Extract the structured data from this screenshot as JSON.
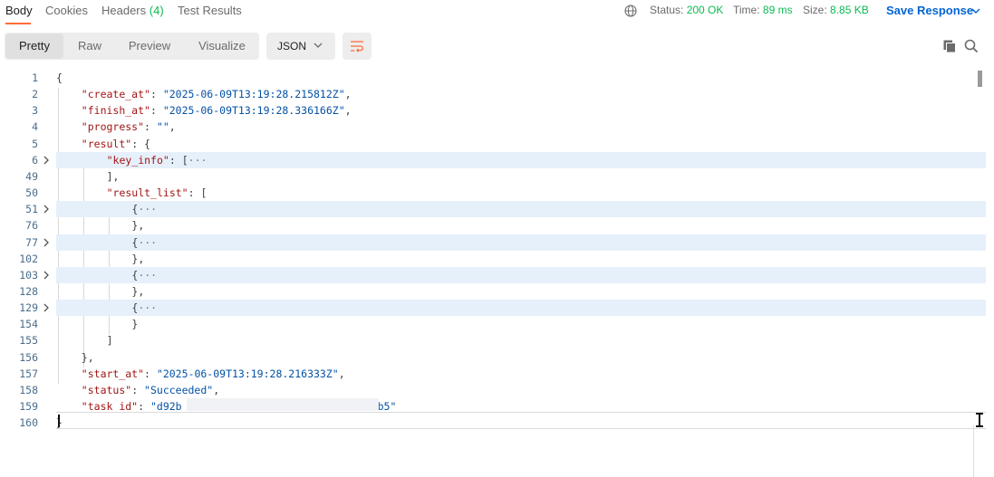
{
  "tabs": [
    {
      "label": "Body"
    },
    {
      "label": "Cookies"
    },
    {
      "label": "Headers",
      "count": "(4)"
    },
    {
      "label": "Test Results"
    }
  ],
  "status": {
    "status_label": "Status:",
    "status_value": "200 OK",
    "time_label": "Time:",
    "time_value": "89 ms",
    "size_label": "Size:",
    "size_value": "8.85 KB"
  },
  "save_response": "Save Response",
  "view_modes": [
    "Pretty",
    "Raw",
    "Preview",
    "Visualize"
  ],
  "format": "JSON",
  "colors": {
    "accent": "#ff6c37",
    "success": "#0cbb52",
    "link": "#0265d2",
    "fold_bg": "#e6f0fb"
  },
  "icons": [
    "globe-icon",
    "chevron-down-icon",
    "wrap-lines-icon",
    "copy-icon",
    "search-icon",
    "fold-arrow-icon"
  ],
  "code_lines": [
    {
      "num": "1",
      "text": "{"
    },
    {
      "num": "2",
      "key": "\"create_at\"",
      "value": "\"2025-06-09T13:19:28.215812Z\"",
      "tail": ","
    },
    {
      "num": "3",
      "key": "\"finish_at\"",
      "value": "\"2025-06-09T13:19:28.336166Z\"",
      "tail": ","
    },
    {
      "num": "4",
      "key": "\"progress\"",
      "value": "\"\"",
      "tail": ","
    },
    {
      "num": "5",
      "key": "\"result\"",
      "tail": "{"
    },
    {
      "num": "6",
      "key": "\"key_info\"",
      "tail": "[",
      "ellipsis": "···"
    },
    {
      "num": "49",
      "text": "],"
    },
    {
      "num": "50",
      "key": "\"result_list\"",
      "tail": "["
    },
    {
      "num": "51",
      "text": "{",
      "ellipsis": "···"
    },
    {
      "num": "76",
      "text": "},"
    },
    {
      "num": "77",
      "text": "{",
      "ellipsis": "···"
    },
    {
      "num": "102",
      "text": "},"
    },
    {
      "num": "103",
      "text": "{",
      "ellipsis": "···"
    },
    {
      "num": "128",
      "text": "},"
    },
    {
      "num": "129",
      "text": "{",
      "ellipsis": "···"
    },
    {
      "num": "154",
      "text": "}"
    },
    {
      "num": "155",
      "text": "]"
    },
    {
      "num": "156",
      "text": "},"
    },
    {
      "num": "157",
      "key": "\"start_at\"",
      "value": "\"2025-06-09T13:19:28.216333Z\"",
      "tail": ","
    },
    {
      "num": "158",
      "key": "\"status\"",
      "value": "\"Succeeded\"",
      "tail": ","
    },
    {
      "num": "159",
      "key": "\"task_id\"",
      "value": "\"d92b",
      "value_end": "b5\""
    },
    {
      "num": "160",
      "text": "}"
    }
  ]
}
